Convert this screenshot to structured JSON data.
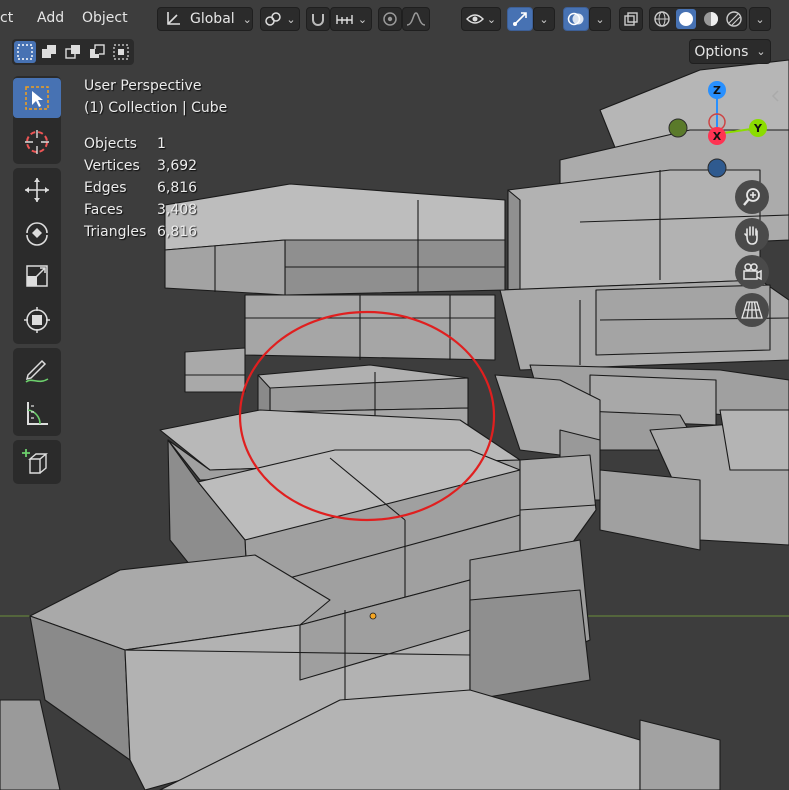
{
  "header": {
    "menu_partial": "ct",
    "menu_add": "Add",
    "menu_object": "Object",
    "orientation": "Global",
    "options_label": "Options"
  },
  "overlay": {
    "view_name": "User Perspective",
    "collection_label": "(1) Collection | Cube",
    "stats": [
      {
        "label": "Objects",
        "value": "1"
      },
      {
        "label": "Vertices",
        "value": "3,692"
      },
      {
        "label": "Edges",
        "value": "6,816"
      },
      {
        "label": "Faces",
        "value": "3,408"
      },
      {
        "label": "Triangles",
        "value": "6,816"
      }
    ]
  },
  "gizmo": {
    "z": "Z",
    "y": "Y",
    "x": "X"
  },
  "colors": {
    "accent": "#4772b3",
    "annotation_circle": "#e01f1f",
    "axis_x": "#ff3352",
    "axis_y": "#8bdc00",
    "axis_z": "#2890ff",
    "horizon_line": "#6a8f3a",
    "origin_dot": "#f5a623"
  },
  "icons": {
    "select_box": "cursor-select-icon",
    "cursor": "3d-cursor-icon",
    "move": "move-icon",
    "rotate": "rotate-icon",
    "scale": "scale-icon",
    "transform": "transform-icon",
    "annotate": "annotate-icon",
    "measure": "measure-icon",
    "add_cube": "add-cube-icon",
    "zoom": "zoom-icon",
    "pan": "hand-icon",
    "camera": "camera-icon",
    "grid": "perspective-grid-icon"
  }
}
